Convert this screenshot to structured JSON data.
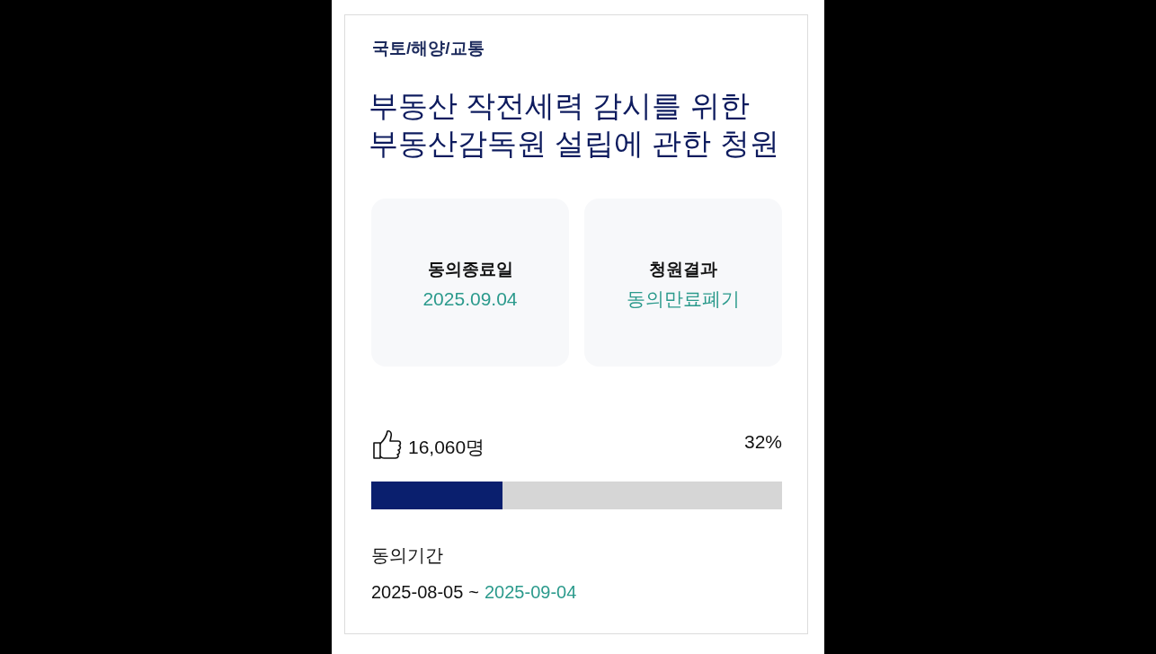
{
  "category": "국토/해양/교통",
  "title": "부동산 작전세력 감시를 위한 부동산감독원 설립에 관한 청원",
  "info_boxes": [
    {
      "label": "동의종료일",
      "value": "2025.09.04"
    },
    {
      "label": "청원결과",
      "value": "동의만료폐기"
    }
  ],
  "agreement": {
    "count": "16,060명",
    "percent": "32%",
    "level": 0.32
  },
  "period": {
    "label": "동의기간",
    "start": "2025-08-05",
    "separator": "~",
    "end": "2025-09-04"
  }
}
